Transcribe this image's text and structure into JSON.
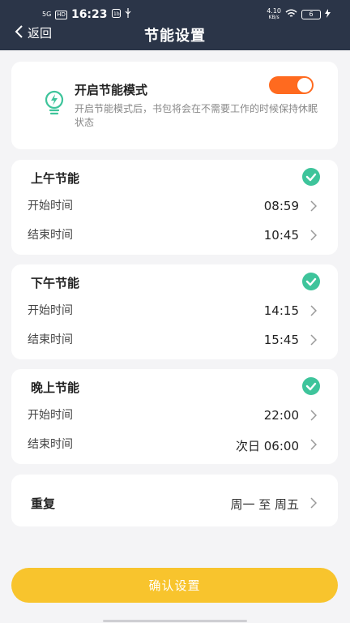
{
  "status_bar": {
    "network": "5G",
    "hd": "HD",
    "time": "16:23",
    "net_speed": "4.10",
    "net_speed_unit": "KB/s",
    "battery": "6"
  },
  "header": {
    "back_label": "返回",
    "title": "节能设置"
  },
  "power_mode": {
    "title": "开启节能模式",
    "description": "开启节能模式后，书包将会在不需要工作的时候保持休眠状态",
    "enabled": true
  },
  "periods": [
    {
      "title": "上午节能",
      "start_label": "开始时间",
      "start_value": "08:59",
      "end_label": "结束时间",
      "end_value": "10:45",
      "checked": true
    },
    {
      "title": "下午节能",
      "start_label": "开始时间",
      "start_value": "14:15",
      "end_label": "结束时间",
      "end_value": "15:45",
      "checked": true
    },
    {
      "title": "晚上节能",
      "start_label": "开始时间",
      "start_value": "22:00",
      "end_label": "结束时间",
      "end_value": "次日 06:00",
      "checked": true
    }
  ],
  "repeat": {
    "label": "重复",
    "value": "周一 至 周五"
  },
  "confirm_label": "确认设置",
  "colors": {
    "header_bg": "#2b3548",
    "toggle_on": "#ff6a1f",
    "check": "#3ec49b",
    "primary_button": "#f8c42d"
  }
}
